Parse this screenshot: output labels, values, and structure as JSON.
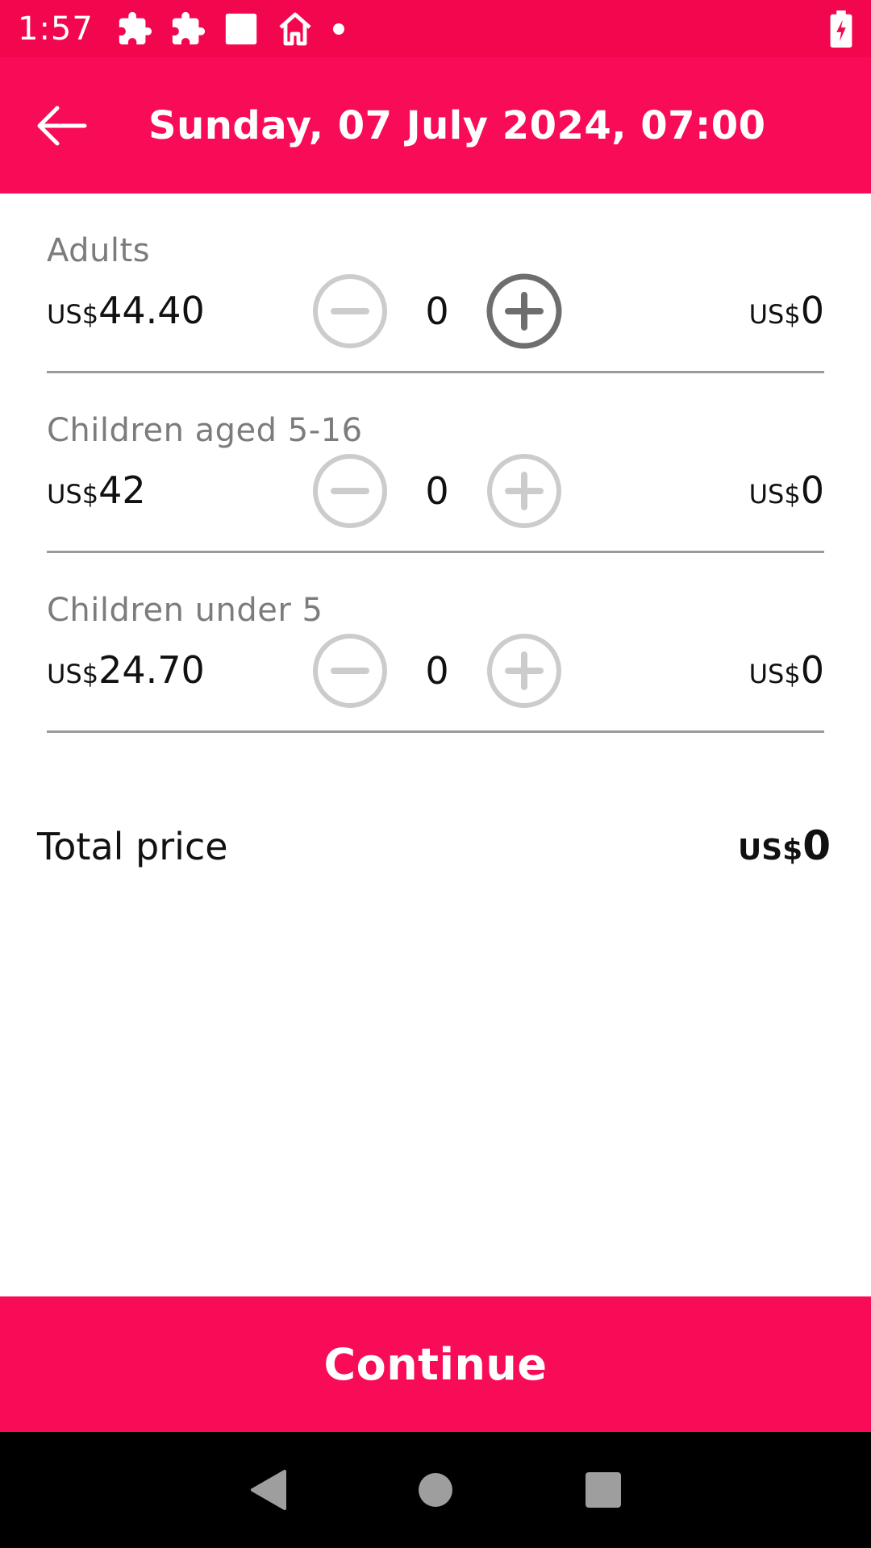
{
  "status_bar": {
    "time": "1:57",
    "icons": [
      "puzzle-icon",
      "puzzle-icon",
      "square-icon",
      "home-icon",
      "dot-icon",
      "battery-charging-icon"
    ]
  },
  "app_bar": {
    "title": "Sunday, 07 July 2024, 07:00",
    "back_icon": "arrow-left-icon"
  },
  "tickets": [
    {
      "label": "Adults",
      "currency": "US$",
      "price": "44.40",
      "count": "0",
      "subtotal_currency": "US$",
      "subtotal": "0",
      "plus_enabled": true,
      "minus_enabled": false
    },
    {
      "label": "Children aged 5-16",
      "currency": "US$",
      "price": "42",
      "count": "0",
      "subtotal_currency": "US$",
      "subtotal": "0",
      "plus_enabled": false,
      "minus_enabled": false
    },
    {
      "label": "Children under 5",
      "currency": "US$",
      "price": "24.70",
      "count": "0",
      "subtotal_currency": "US$",
      "subtotal": "0",
      "plus_enabled": false,
      "minus_enabled": false
    }
  ],
  "total": {
    "label": "Total price",
    "currency": "US$",
    "value": "0"
  },
  "continue_button": {
    "label": "Continue"
  },
  "colors": {
    "status_bar": "#f2074e",
    "accent": "#f80c58",
    "enabled_stepper": "#6e6e6e",
    "disabled_stepper": "#cccccc",
    "divider": "#9a9a9a"
  }
}
